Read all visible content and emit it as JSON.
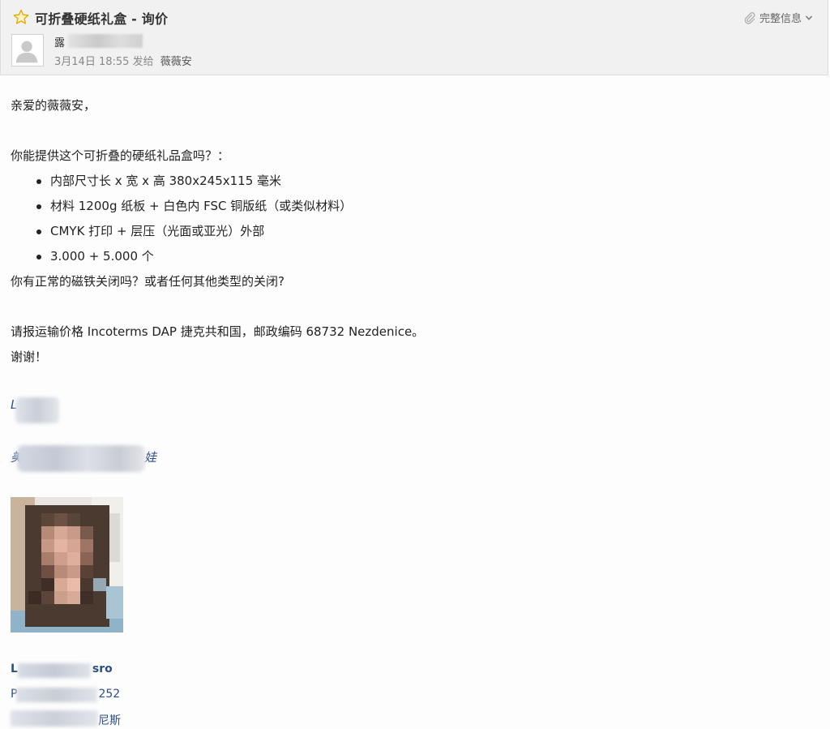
{
  "header": {
    "subject": "可折叠硬纸礼盒 - 询价",
    "sender_prefix": "露",
    "sender_suffix": "",
    "date": "3月14日 18:55",
    "sent_to_label": "发给",
    "recipient": "薇薇安",
    "full_info_label": "完整信息"
  },
  "body": {
    "greeting": "亲爱的薇薇安，",
    "intro": "你能提供这个可折叠的硬纸礼品盒吗？：",
    "bullets": [
      "内部尺寸长 x 宽 x 高 380x245x115 毫米",
      "材料 1200g 纸板 + 白色内 FSC 铜版纸（或类似材料）",
      "CMYK 打印 + 层压（光面或亚光）外部",
      "3.000 + 5.000 个"
    ],
    "question": "你有正常的磁铁关闭吗？或者任何其他类型的关闭?",
    "shipping": "请报运输价格 Incoterms DAP 捷克共和国，邮政编码 68732 Nezdenice。",
    "thanks": "谢谢！"
  },
  "signature": {
    "name_fragment": "L",
    "title_fragment_start": "美",
    "title_fragment_end": "娃",
    "company_start": "L",
    "company_end": "sro",
    "address_start": "P",
    "address_end": "252",
    "city_end": "尼斯"
  },
  "colors": {
    "header_bg": "#f1f1f1",
    "link_blue": "#2a4f88",
    "star_yellow": "#f5c518"
  }
}
